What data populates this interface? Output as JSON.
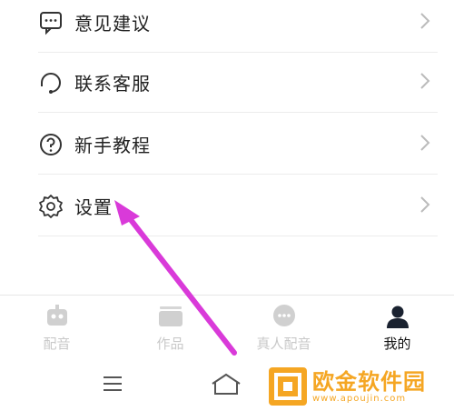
{
  "menu": {
    "items": [
      {
        "label": "意见建议",
        "icon": "feedback-icon"
      },
      {
        "label": "联系客服",
        "icon": "customer-service-icon"
      },
      {
        "label": "新手教程",
        "icon": "help-icon"
      },
      {
        "label": "设置",
        "icon": "settings-icon"
      }
    ]
  },
  "tabbar": {
    "tabs": [
      {
        "label": "配音",
        "icon": "robot-icon",
        "active": false
      },
      {
        "label": "作品",
        "icon": "folder-icon",
        "active": false
      },
      {
        "label": "真人配音",
        "icon": "chat-bubble-icon",
        "active": false
      },
      {
        "label": "我的",
        "icon": "person-icon",
        "active": true
      }
    ]
  },
  "system_nav": {
    "buttons": [
      "menu-icon",
      "home-icon",
      "back-icon"
    ]
  },
  "annotation": {
    "color": "#d93ad9",
    "points_to": "设置"
  },
  "watermark": {
    "title": "欧金软件园",
    "url": "www.apoujin.com",
    "color": "#f5a623"
  }
}
